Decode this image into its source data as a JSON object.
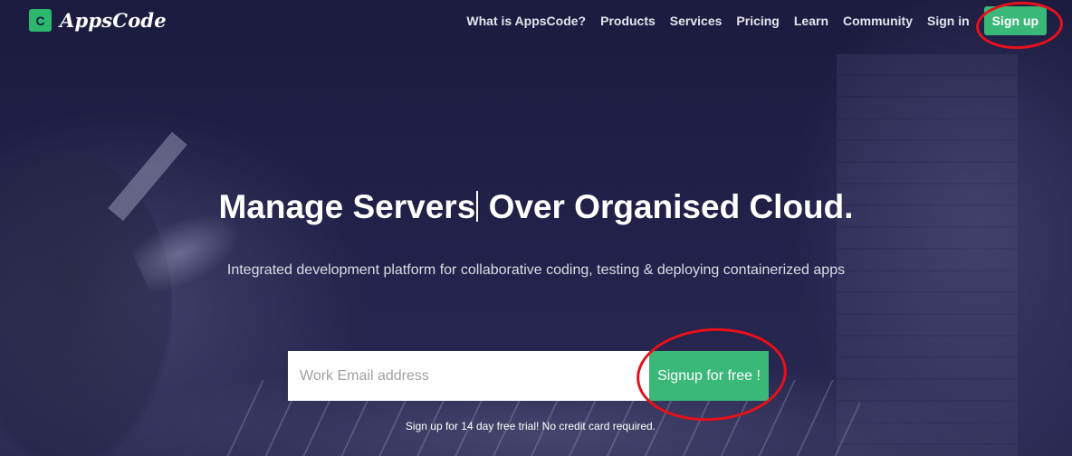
{
  "brand": {
    "logo_text": "C",
    "name": "AppsCode"
  },
  "nav": {
    "links": [
      "What is AppsCode?",
      "Products",
      "Services",
      "Pricing",
      "Learn",
      "Community",
      "Sign in"
    ],
    "signup_label": "Sign up"
  },
  "hero": {
    "title_part1": "Manage Servers",
    "title_part2": "Over Organised Cloud.",
    "subtitle": "Integrated development platform for collaborative coding, testing & deploying containerized apps"
  },
  "signup_form": {
    "email_placeholder": "Work Email address",
    "email_value": "",
    "cta_label": "Signup for free !",
    "note": "Sign up for 14 day free trial! No credit card required."
  },
  "colors": {
    "accent": "#3ab878",
    "background": "#1b1b3f",
    "annotation": "#e8101a"
  },
  "icons": {
    "logo": "appscode-logo-icon"
  }
}
